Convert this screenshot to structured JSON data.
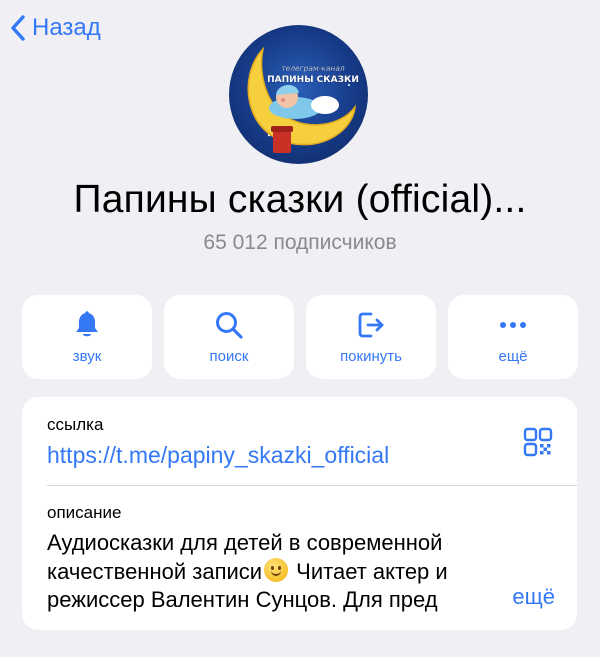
{
  "nav": {
    "back_label": "Назад"
  },
  "channel": {
    "logo_text_top": "телеграм-канал",
    "logo_text_main": "ПАПИНЫ СКАЗКИ",
    "title": "Папины сказки (official)...",
    "subscribers": "65 012 подписчиков"
  },
  "actions": [
    {
      "label": "звук",
      "icon": "bell-icon"
    },
    {
      "label": "поиск",
      "icon": "search-icon"
    },
    {
      "label": "покинуть",
      "icon": "leave-icon"
    },
    {
      "label": "ещё",
      "icon": "more-icon"
    }
  ],
  "info": {
    "link_caption": "ссылка",
    "link": "https://t.me/papiny_skazki_official",
    "description_caption": "описание",
    "description_lines": [
      "Аудиосказки для детей в современной",
      "качественной записи",
      " Читает актер и",
      "режиссер Валентин Сунцов. Для пред"
    ],
    "more_label": "ещё"
  },
  "colors": {
    "accent": "#3478f6",
    "background": "#efeff4",
    "secondary_text": "#8a8a8e"
  }
}
